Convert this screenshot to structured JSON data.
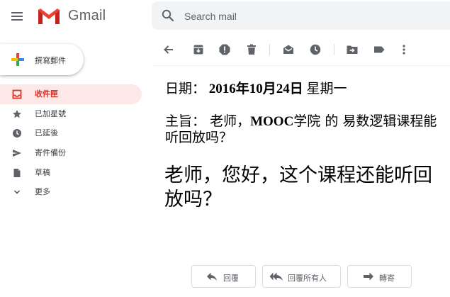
{
  "header": {
    "app_name": "Gmail",
    "menu_icon": "hamburger-menu-icon",
    "logo_icon": "gmail-m-logo",
    "search": {
      "placeholder": "Search mail",
      "value": "",
      "icon": "search-icon"
    }
  },
  "sidebar": {
    "compose_label": "撰寫郵件",
    "items": [
      {
        "label": "收件匣",
        "icon": "inbox-icon",
        "active": true
      },
      {
        "label": "已加星號",
        "icon": "star-icon",
        "active": false
      },
      {
        "label": "已延後",
        "icon": "clock-icon",
        "active": false
      },
      {
        "label": "寄件備份",
        "icon": "send-icon",
        "active": false
      },
      {
        "label": "草稿",
        "icon": "draft-icon",
        "active": false
      },
      {
        "label": "更多",
        "icon": "chevron-down-icon",
        "active": false
      }
    ]
  },
  "toolbar": {
    "buttons": [
      "back-arrow-icon",
      "archive-icon",
      "report-spam-icon",
      "delete-icon",
      "mark-unread-icon",
      "snooze-icon",
      "move-to-icon",
      "label-icon",
      "more-vert-icon"
    ]
  },
  "message": {
    "date_label": "日期：",
    "date_value": "2016年10月24日",
    "weekday": "星期一",
    "subject_label": "主旨：",
    "subject_prefix": "老师，",
    "subject_bold": "MOOC",
    "subject_rest": "学院 的 易数逻辑课程能听回放吗？",
    "body": "老师，您好，这个课程还能听回放吗？"
  },
  "actions": {
    "reply_label": "回覆",
    "reply_all_label": "回覆所有人",
    "forward_label": "轉寄"
  },
  "colors": {
    "accent_red": "#d93025",
    "active_bg": "#fce8e6",
    "icon_gray": "#5f6368"
  }
}
